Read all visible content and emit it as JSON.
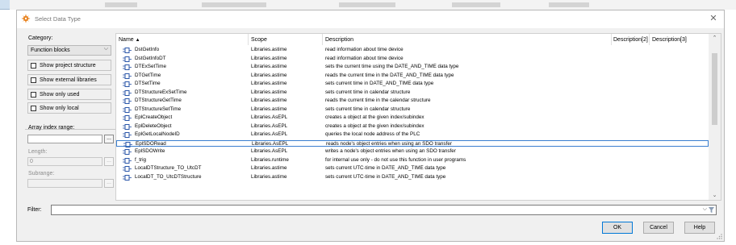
{
  "dialog": {
    "title": "Select Data Type",
    "close_icon": "close-icon",
    "title_icon": "automation-studio-icon"
  },
  "sidebar": {
    "category_label": "Category:",
    "category_value": "Function blocks",
    "checkboxes": [
      {
        "label": "Show project structure",
        "checked": false
      },
      {
        "label": "Show external libraries",
        "checked": false
      },
      {
        "label": "Show only used",
        "checked": false
      },
      {
        "label": "Show only local",
        "checked": false
      }
    ],
    "array_index_label": "Array index range:",
    "array_index_value": "",
    "length_label": "Length:",
    "length_value": "0",
    "subrange_label": "Subrange:",
    "subrange_value": "",
    "ellipsis": "..."
  },
  "table": {
    "columns": [
      "Name",
      "Scope",
      "Description",
      "Description[2]",
      "Description[3]"
    ],
    "sort_indicator": "▲",
    "row_icon": "function-block-icon",
    "selected_index": 15,
    "rows": [
      {
        "name": "DstGetInfo",
        "scope": "Libraries.astime",
        "desc": "read information about time device"
      },
      {
        "name": "DstGetInfoDT",
        "scope": "Libraries.astime",
        "desc": "read information about time device"
      },
      {
        "name": "DTExSetTime",
        "scope": "Libraries.astime",
        "desc": "sets the current time using the DATE_AND_TIME data type"
      },
      {
        "name": "DTGetTime",
        "scope": "Libraries.astime",
        "desc": "reads the current time in the DATE_AND_TIME data type"
      },
      {
        "name": "DTSetTime",
        "scope": "Libraries.astime",
        "desc": "sets current time in DATE_AND_TIME data type"
      },
      {
        "name": "DTStructureExSetTime",
        "scope": "Libraries.astime",
        "desc": "sets current time in calendar structure"
      },
      {
        "name": "DTStructureGetTime",
        "scope": "Libraries.astime",
        "desc": "reads the current time in the calendar structure"
      },
      {
        "name": "DTStructureSetTime",
        "scope": "Libraries.astime",
        "desc": "sets current time in calendar structure"
      },
      {
        "name": "EplCreateObject",
        "scope": "Libraries.AsEPL",
        "desc": "creates a object at the given index/subindex"
      },
      {
        "name": "EplDeleteObject",
        "scope": "Libraries.AsEPL",
        "desc": "creates a object at the given index/subindex"
      },
      {
        "name": "EplGetLocalNodeID",
        "scope": "Libraries.AsEPL",
        "desc": "queries the local node address of the PLC"
      },
      {
        "name": "EplSDORead",
        "scope": "Libraries.AsEPL",
        "desc": "reads node's object entries when using an SDO transfer"
      },
      {
        "name": "EplSDOWrite",
        "scope": "Libraries.AsEPL",
        "desc": "writes a node's object entries when using an SDO transfer"
      },
      {
        "name": "f_trig",
        "scope": "Libraries.runtime",
        "desc": "for internal use only - do not use this function in user programs"
      },
      {
        "name": "LocalDTStructure_TO_UtcDT",
        "scope": "Libraries.astime",
        "desc": "sets current UTC-time in DATE_AND_TIME data type"
      },
      {
        "name": "LocalDT_TO_UtcDTStructure",
        "scope": "Libraries.astime",
        "desc": "sets current UTC-time in DATE_AND_TIME data type"
      }
    ]
  },
  "filter": {
    "label": "Filter:",
    "value": "",
    "clear_icon": "filter-clear-icon"
  },
  "buttons": {
    "ok": "OK",
    "cancel": "Cancel",
    "help": "Help"
  }
}
